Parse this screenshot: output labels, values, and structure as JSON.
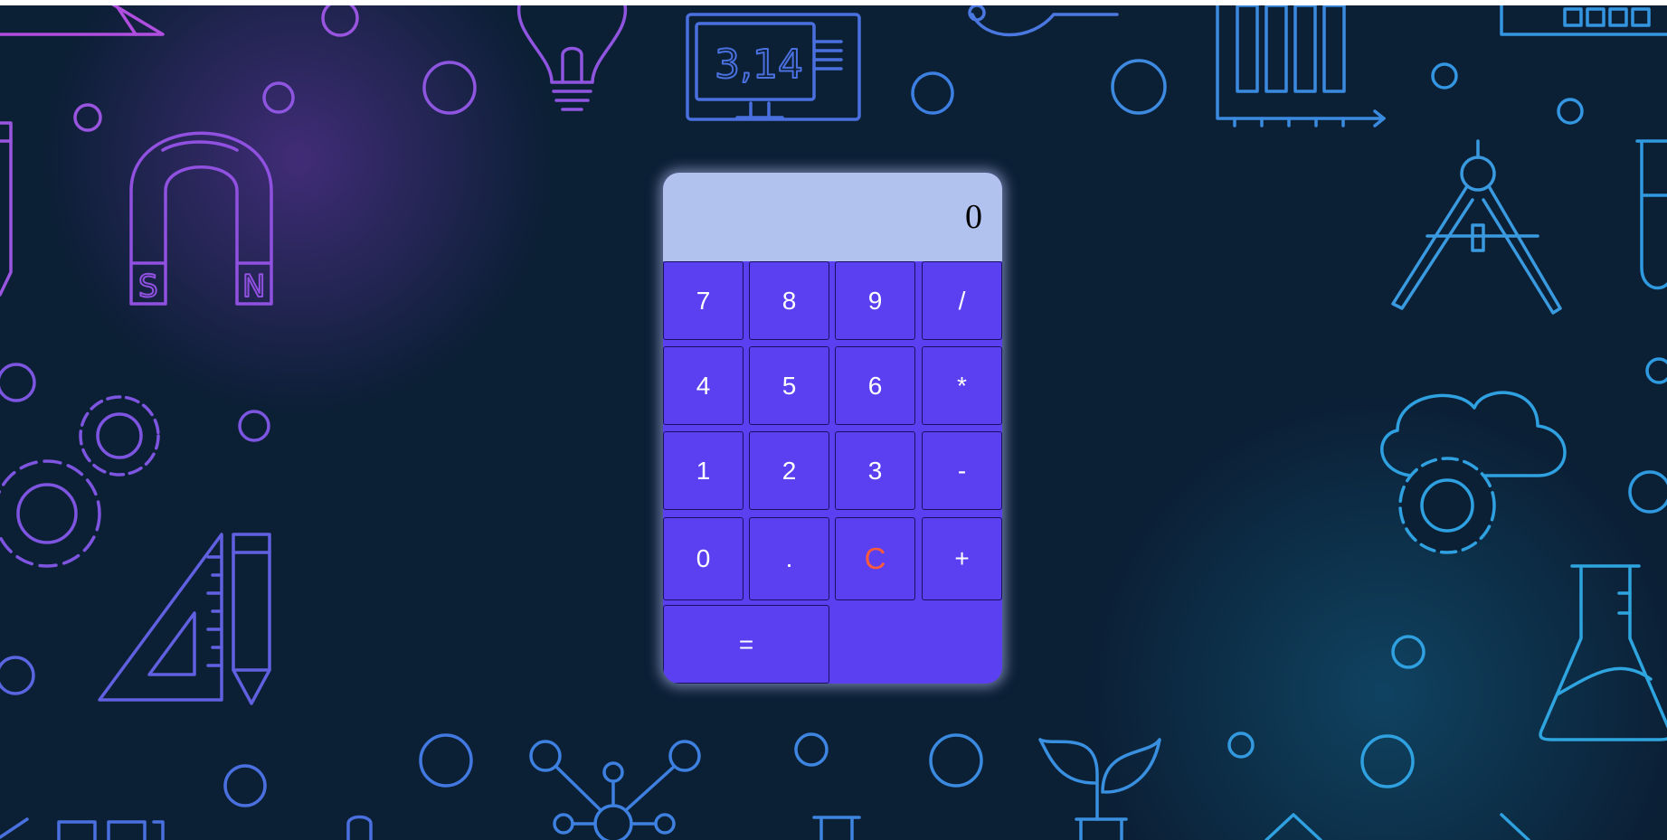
{
  "calculator": {
    "display_value": "0",
    "keys": {
      "seven": "7",
      "eight": "8",
      "nine": "9",
      "divide": "/",
      "four": "4",
      "five": "5",
      "six": "6",
      "multiply": "*",
      "one": "1",
      "two": "2",
      "three": "3",
      "minus": "-",
      "zero": "0",
      "decimal": ".",
      "clear": "C",
      "plus": "+",
      "equals": "="
    }
  },
  "background": {
    "pi_label": "3,14",
    "magnet_south": "S",
    "magnet_north": "N",
    "icons": [
      "lightbulb-icon",
      "monitor-icon",
      "bar-chart-icon",
      "magnet-icon",
      "gears-icon",
      "set-square-icon",
      "pencil-icon",
      "compass-icon",
      "cloud-gear-icon",
      "flask-icon",
      "molecule-icon",
      "plant-icon",
      "test-tube-icon"
    ]
  },
  "colors": {
    "background": "#0b1f35",
    "calculator_body": "#5a40f0",
    "display": "#b2c2ee",
    "clear_key": "#ff5a3a",
    "key_text": "#ffffff",
    "icon_purple": "#8a55e0",
    "icon_blue": "#2f8fe0"
  }
}
